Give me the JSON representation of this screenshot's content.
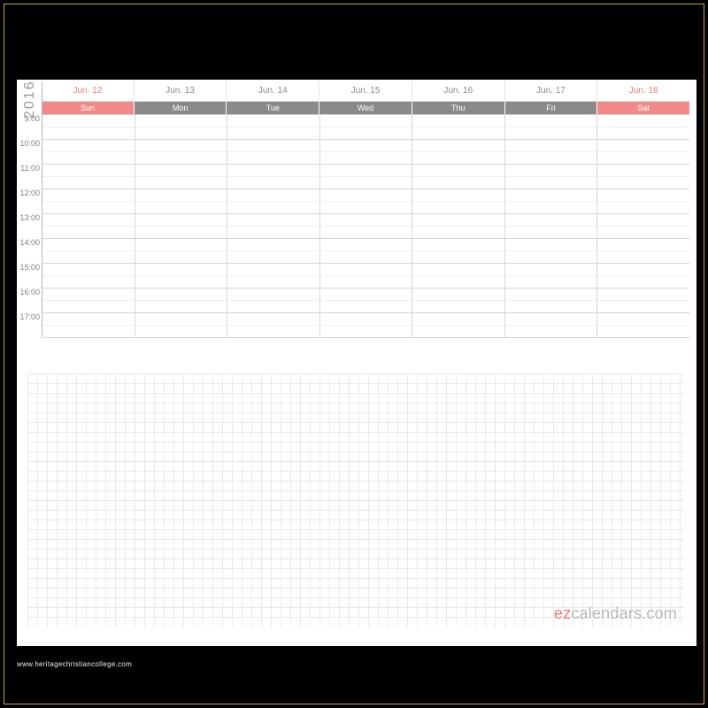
{
  "year": "2016",
  "dates": [
    {
      "label": "Jun. 12",
      "day": "Sun",
      "weekend": true
    },
    {
      "label": "Jun. 13",
      "day": "Mon",
      "weekend": false
    },
    {
      "label": "Jun. 14",
      "day": "Tue",
      "weekend": false
    },
    {
      "label": "Jun. 15",
      "day": "Wed",
      "weekend": false
    },
    {
      "label": "Jun. 16",
      "day": "Thu",
      "weekend": false
    },
    {
      "label": "Jun. 17",
      "day": "Fri",
      "weekend": false
    },
    {
      "label": "Jun. 18",
      "day": "Sat",
      "weekend": true
    }
  ],
  "hours": [
    "9:00",
    "10:00",
    "11:00",
    "12:00",
    "13:00",
    "14:00",
    "15:00",
    "16:00",
    "17:00"
  ],
  "brand": {
    "accent": "ez",
    "rest": "calendars.com"
  },
  "watermark": "www.heritagechristiancollege.com"
}
